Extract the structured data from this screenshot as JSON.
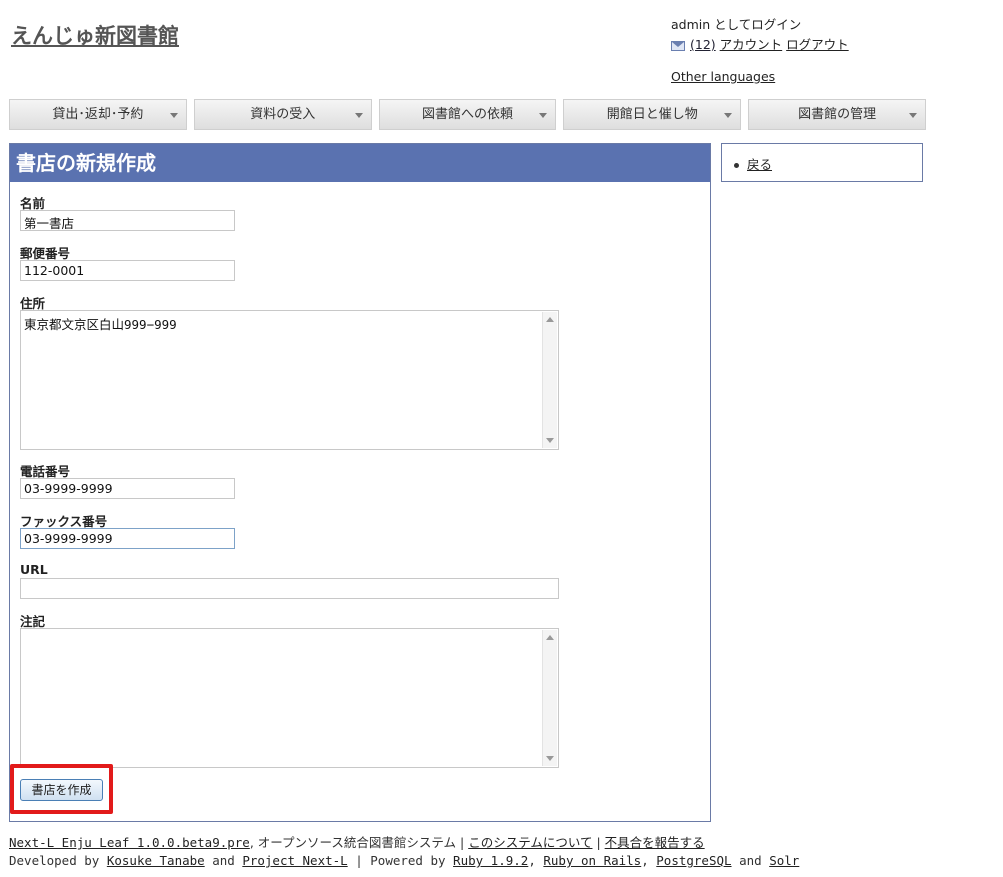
{
  "site": {
    "title": "えんじゅ新図書館"
  },
  "user": {
    "login_text": "admin としてログイン",
    "messages": "(12)",
    "account": "アカウント",
    "logout": "ログアウト",
    "other_languages": "Other languages"
  },
  "menu": [
    {
      "label": "貸出･返却･予約"
    },
    {
      "label": "資料の受入"
    },
    {
      "label": "図書館への依頼"
    },
    {
      "label": "開館日と催し物"
    },
    {
      "label": "図書館の管理"
    }
  ],
  "form": {
    "heading": "書店の新規作成",
    "name_label": "名前",
    "name_value": "第一書店",
    "zip_label": "郵便番号",
    "zip_value": "112-0001",
    "address_label": "住所",
    "address_value": "東京都文京区白山999−999",
    "tel_label": "電話番号",
    "tel_value": "03-9999-9999",
    "fax_label": "ファックス番号",
    "fax_value": "03-9999-9999",
    "url_label": "URL",
    "url_value": "",
    "note_label": "注記",
    "note_value": "",
    "submit_label": "書店を作成"
  },
  "sidebar": {
    "back": "戻る"
  },
  "footer": {
    "product": "Next-L Enju Leaf 1.0.0.beta9.pre",
    "product_suffix": ", オープンソース統合図書館システム",
    "sep1": " | ",
    "about": "このシステムについて",
    "sep2": " | ",
    "report": "不具合を報告する",
    "developed_by": "Developed by ",
    "author": "Kosuke Tanabe",
    "and1": " and ",
    "project": "Project Next-L",
    "powered": " | Powered by ",
    "ruby": "Ruby 1.9.2",
    "comma1": ", ",
    "rails": "Ruby on Rails",
    "comma2": ", ",
    "postgres": "PostgreSQL",
    "and2": " and ",
    "solr": "Solr"
  },
  "colors": {
    "header_bg": "#5a72b0",
    "highlight": "#e21a1a",
    "panel_border": "#6a7aa6"
  }
}
